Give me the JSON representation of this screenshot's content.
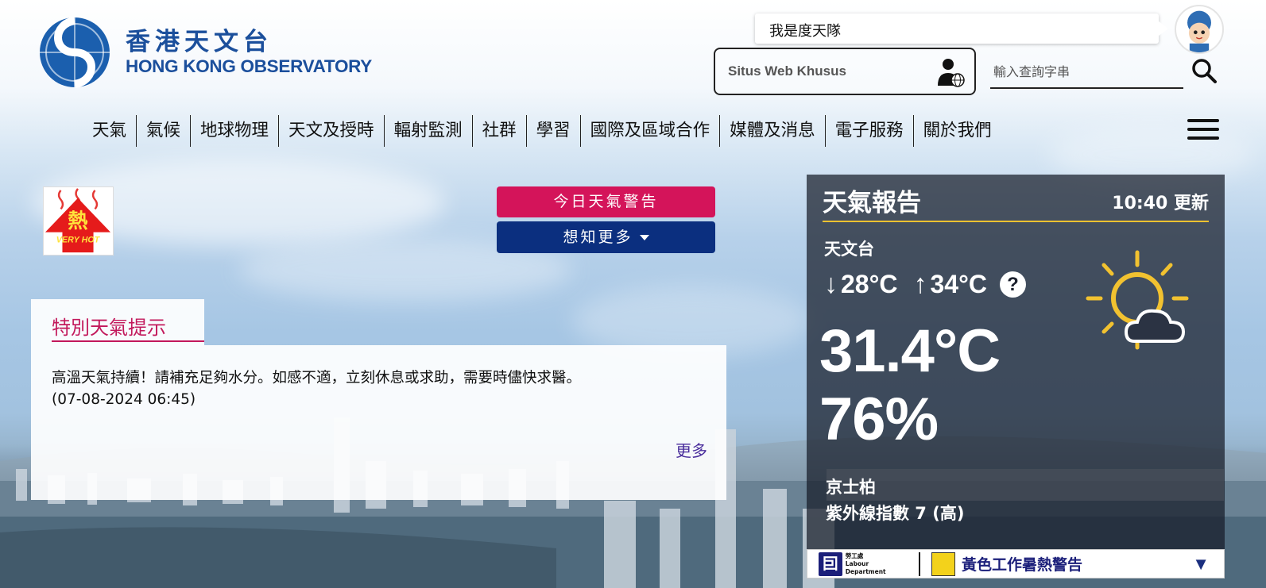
{
  "header": {
    "logo_zh": "香港天文台",
    "logo_en": "HONG KONG OBSERVATORY",
    "chatbot_prompt": "我是度天隊",
    "special_site_label": "Situs Web Khusus",
    "search_placeholder": "輸入查詢字串"
  },
  "nav": {
    "items": [
      "天氣",
      "氣候",
      "地球物理",
      "天文及授時",
      "輻射監測",
      "社群",
      "學習",
      "國際及區域合作",
      "媒體及消息",
      "電子服務",
      "關於我們"
    ]
  },
  "warning_badge": {
    "icon": "very-hot-warning-icon",
    "zh": "熱",
    "en": "VERY HOT"
  },
  "buttons": {
    "today_warning": "今日天氣警告",
    "learn_more": "想知更多"
  },
  "special_tip": {
    "title": "特別天氣提示",
    "text": "高溫天氣持續！請補充足夠水分。如感不適，立刻休息或求助，需要時儘快求醫。",
    "datetime": "(07-08-2024 06:45)",
    "more_label": "更多"
  },
  "weather_report": {
    "title": "天氣報告",
    "updated": "10:40 更新",
    "station": "天文台",
    "min_temp": "28°C",
    "max_temp": "34°C",
    "help": "?",
    "temperature": "31.4°C",
    "humidity": "76%",
    "uv_station": "京士柏",
    "uv_index": "紫外線指數 7 (高)",
    "icon": "sunny-periods-icon"
  },
  "labour_bar": {
    "dept_zh": "勞工處",
    "dept_en": "Labour Department",
    "warning_text": "黃色工作暑熱警告",
    "arrow": "▼"
  },
  "colors": {
    "brand_blue": "#1b4f9c",
    "warning_red": "#d4145a",
    "navy": "#0b2f7f",
    "accent_yellow": "#f2c230"
  }
}
